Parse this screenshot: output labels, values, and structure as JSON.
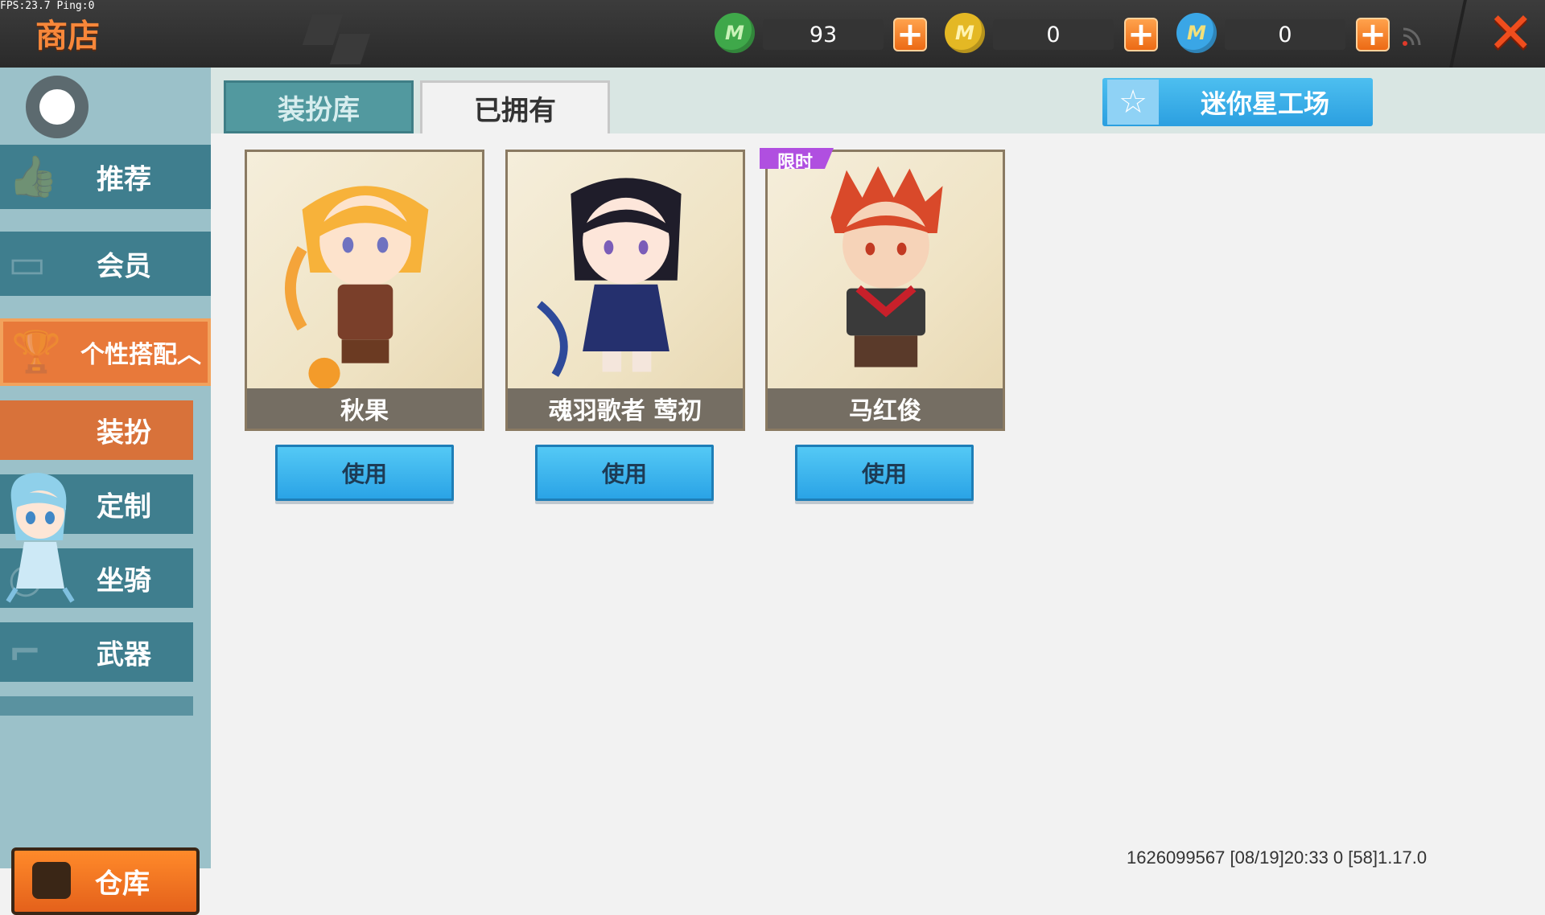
{
  "status": {
    "fps_text": "FPS:23.7  Ping:0"
  },
  "header": {
    "title": "商店",
    "currencies": [
      {
        "name": "mini-bean",
        "amount": "93",
        "color": "#3fa84a"
      },
      {
        "name": "mini-coin",
        "amount": "0",
        "color": "#e4b824"
      },
      {
        "name": "mini-point",
        "amount": "0",
        "color": "#3aa6e6"
      }
    ]
  },
  "sidebar": {
    "items": [
      {
        "label": "推荐"
      },
      {
        "label": "会员"
      },
      {
        "label": "个性搭配︿"
      },
      {
        "label": "装扮"
      },
      {
        "label": "定制"
      },
      {
        "label": "坐骑"
      },
      {
        "label": "武器"
      }
    ],
    "warehouse_label": "仓库"
  },
  "tabs": [
    {
      "label": "装扮库"
    },
    {
      "label": "已拥有"
    }
  ],
  "workshop_label": "迷你星工场",
  "cards": [
    {
      "name": "秋果",
      "button": "使用"
    },
    {
      "name": "魂羽歌者 莺初",
      "button": "使用"
    },
    {
      "name": "马红俊",
      "button": "使用",
      "tag": "限时"
    }
  ],
  "footer": {
    "info": "1626099567   [08/19]20:33 0 [58]1.17.0"
  }
}
